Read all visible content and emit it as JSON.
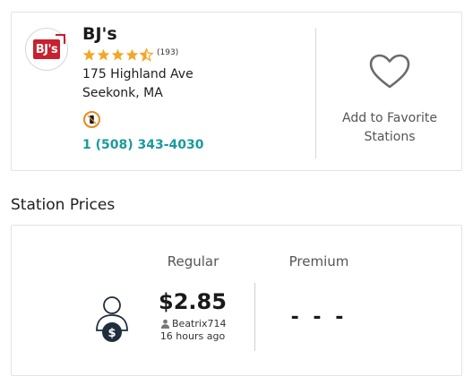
{
  "station": {
    "logo_text": "BJ's",
    "name": "BJ's",
    "rating_stars": 4.5,
    "rating_count": "(193)",
    "address_line1": "175 Highland Ave",
    "address_line2": "Seekonk, MA",
    "amenity_icon": "no-smoking-phone-icon",
    "phone": "1 (508) 343-4030",
    "favorite_label_line1": "Add to Favorite",
    "favorite_label_line2": "Stations"
  },
  "prices_section": {
    "title": "Station Prices",
    "fuels": [
      {
        "grade": "Regular",
        "price": "$2.85",
        "reporter": "Beatrix714",
        "reported_ago": "16 hours ago"
      },
      {
        "grade": "Premium",
        "price": "- - -"
      }
    ]
  },
  "colors": {
    "star": "#f5a623",
    "phone": "#1a9a9c",
    "logo": "#c8202f",
    "amenity_ring": "#e88a22",
    "dollar_badge": "#1f2d3d"
  }
}
